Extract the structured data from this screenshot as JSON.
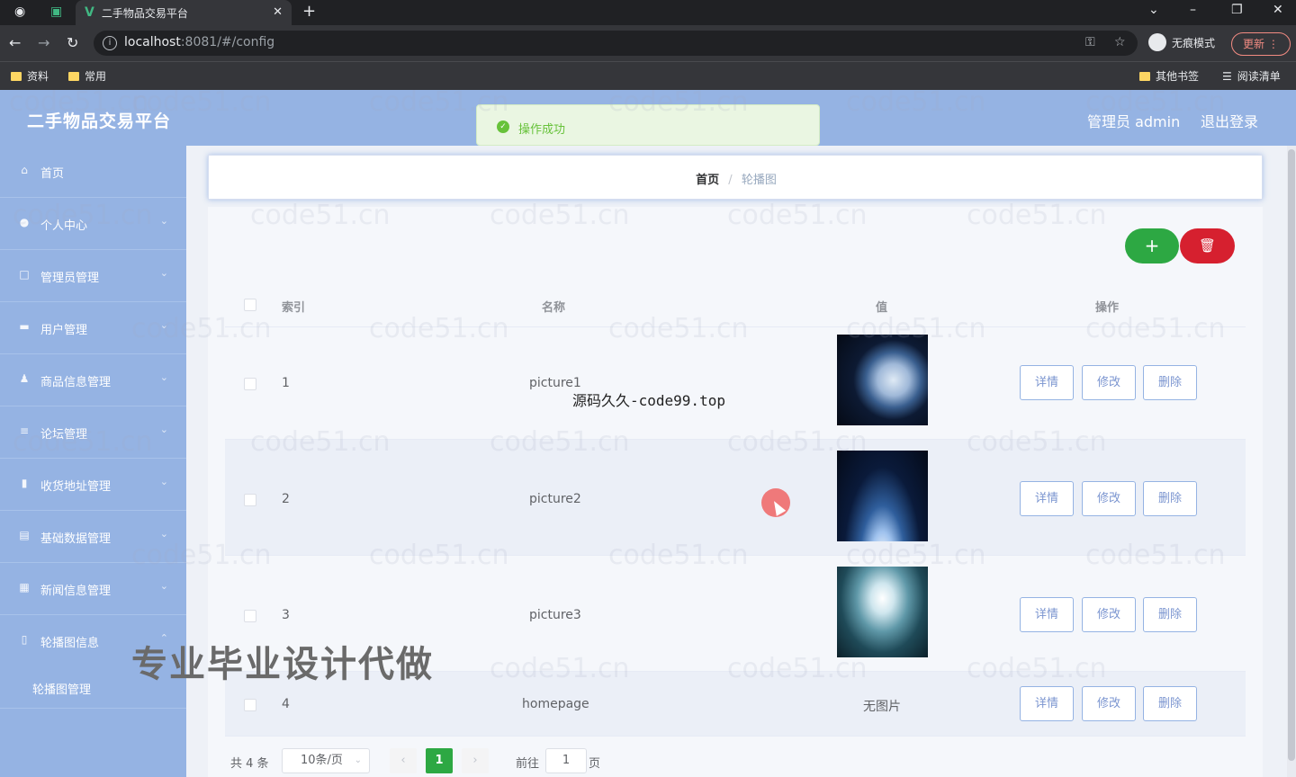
{
  "browser": {
    "tab_title": "二手物品交易平台",
    "url_host": "localhost",
    "url_rest": ":8081/#/config",
    "incognito_label": "无痕模式",
    "update_label": "更新",
    "bookmarks": [
      "资料",
      "常用"
    ],
    "bookmarks_right": [
      "其他书签",
      "阅读清单"
    ]
  },
  "header": {
    "title": "二手物品交易平台",
    "admin": "管理员 admin",
    "logout": "退出登录"
  },
  "toast": {
    "message": "操作成功"
  },
  "sidebar": {
    "items": [
      {
        "label": "首页",
        "icon": "home-icon"
      },
      {
        "label": "个人中心",
        "icon": "user-icon"
      },
      {
        "label": "管理员管理",
        "icon": "admin-icon"
      },
      {
        "label": "用户管理",
        "icon": "users-icon"
      },
      {
        "label": "商品信息管理",
        "icon": "goods-icon"
      },
      {
        "label": "论坛管理",
        "icon": "forum-icon"
      },
      {
        "label": "收货地址管理",
        "icon": "address-icon"
      },
      {
        "label": "基础数据管理",
        "icon": "data-icon"
      },
      {
        "label": "新闻信息管理",
        "icon": "news-icon"
      },
      {
        "label": "轮播图信息",
        "icon": "carousel-icon"
      }
    ],
    "sub_item": "轮播图管理"
  },
  "breadcrumb": {
    "home": "首页",
    "sep": "/",
    "current": "轮播图"
  },
  "table": {
    "headers": {
      "index": "索引",
      "name": "名称",
      "value": "值",
      "ops": "操作"
    },
    "rows": [
      {
        "index": "1",
        "name": "picture1",
        "value_type": "image"
      },
      {
        "index": "2",
        "name": "picture2",
        "value_type": "image"
      },
      {
        "index": "3",
        "name": "picture3",
        "value_type": "image"
      },
      {
        "index": "4",
        "name": "homepage",
        "value_text": "无图片"
      }
    ],
    "op_labels": {
      "detail": "详情",
      "edit": "修改",
      "delete": "删除"
    }
  },
  "pager": {
    "total": "共 4 条",
    "page_size": "10条/页",
    "current_page": "1",
    "goto_label": "前往",
    "goto_value": "1",
    "page_unit": "页"
  },
  "overlay": {
    "source_text": "源码久久-code99.top",
    "promo": "专业毕业设计代做",
    "watermark": "code51.cn"
  },
  "colors": {
    "theme": "#95b3e3",
    "add_button": "#2da843",
    "delete_button": "#d6202f",
    "success": "#67c23a"
  }
}
